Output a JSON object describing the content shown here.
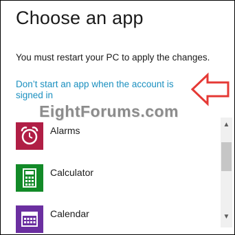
{
  "dialog": {
    "title": "Choose an app",
    "message": "You must restart your PC to apply the changes.",
    "dont_start_link": "Don’t start an app when the account is signed in"
  },
  "watermark": "EightForums.com",
  "apps": [
    {
      "label": "Alarms",
      "icon": "alarm-clock-icon",
      "color": "#b01e45"
    },
    {
      "label": "Calculator",
      "icon": "calculator-icon",
      "color": "#128a28"
    },
    {
      "label": "Calendar",
      "icon": "calendar-icon",
      "color": "#6b2fa0"
    }
  ],
  "annotation_color": "#e53935",
  "link_color": "#1a8fbf"
}
